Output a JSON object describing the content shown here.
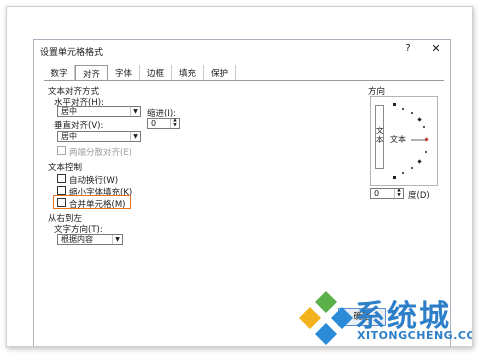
{
  "dialog": {
    "title": "设置单元格格式",
    "help": "?",
    "close": "✕"
  },
  "tabs": [
    {
      "label": "数字",
      "active": false
    },
    {
      "label": "对齐",
      "active": true
    },
    {
      "label": "字体",
      "active": false
    },
    {
      "label": "边框",
      "active": false
    },
    {
      "label": "填充",
      "active": false
    },
    {
      "label": "保护",
      "active": false
    }
  ],
  "text_alignment": {
    "section_title": "文本对齐方式",
    "horizontal_label": "水平对齐(H):",
    "horizontal_value": "居中",
    "indent_label": "缩进(I):",
    "indent_value": "0",
    "vertical_label": "垂直对齐(V):",
    "vertical_value": "居中",
    "distributed_label": "两端分散对齐(E)"
  },
  "text_control": {
    "section_title": "文本控制",
    "wrap_label": "自动换行(W)",
    "shrink_label": "缩小字体填充(K)",
    "merge_label": "合并单元格(M)"
  },
  "rtl": {
    "section_title": "从右到左",
    "direction_label": "文字方向(T):",
    "direction_value": "根据内容"
  },
  "orientation": {
    "title": "方向",
    "vertical_text": "文本",
    "horizontal_text": "文本",
    "degrees_value": "0",
    "degrees_label": "度(D)"
  },
  "ok_button": "确定",
  "watermark": {
    "main": "系统城",
    "sub": "XITONGCHENG.COM"
  },
  "colors": {
    "highlight": "#e8711c",
    "watermark": "#2c7fc8",
    "marker": "#c0392b"
  }
}
